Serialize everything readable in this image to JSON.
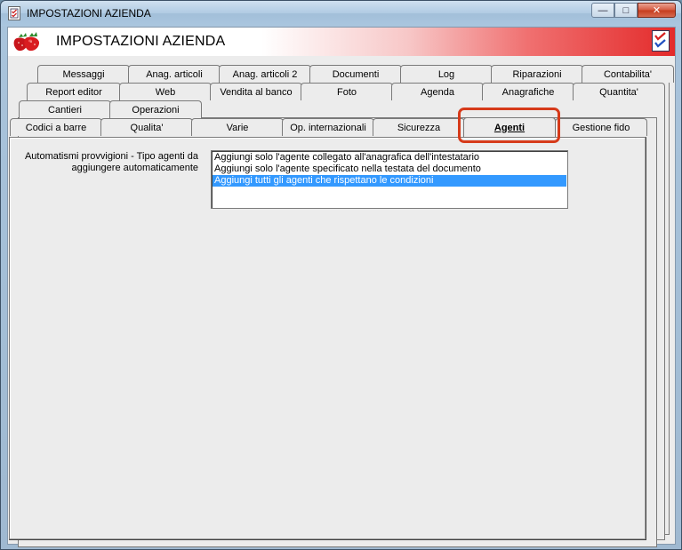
{
  "window": {
    "title": "IMPOSTAZIONI AZIENDA",
    "buttons": {
      "minimize": "—",
      "maximize": "□",
      "close": "✕"
    }
  },
  "header": {
    "title": "IMPOSTAZIONI AZIENDA",
    "logo_icon": "strawberry-icon",
    "right_icon": "checklist-icon"
  },
  "tabs": {
    "row1": [
      "Messaggi",
      "Anag. articoli",
      "Anag. articoli 2",
      "Documenti",
      "Log",
      "Riparazioni",
      "Contabilita'"
    ],
    "row2": [
      "Report editor",
      "Web",
      "Vendita al banco",
      "Foto",
      "Agenda",
      "Anagrafiche",
      "Quantita'"
    ],
    "row3": [
      "Cantieri",
      "Operazioni"
    ],
    "row4": [
      "Codici a barre",
      "Qualita'",
      "Varie",
      "Op. internazionali",
      "Sicurezza",
      "Agenti",
      "Gestione fido"
    ],
    "active": "Agenti"
  },
  "panel": {
    "field_label_line1": "Automatismi provvigioni - Tipo agenti da",
    "field_label_line2": "aggiungere automaticamente",
    "options": [
      "Aggiungi solo l'agente collegato all'anagrafica dell'intestatario",
      "Aggiungi solo l'agente specificato nella testata del documento",
      "Aggiungi tutti gli agenti che rispettano le condizioni"
    ],
    "selected_option": "Aggiungi tutti gli agenti che rispettano le condizioni"
  },
  "colors": {
    "selection": "#3399ff",
    "highlight_ring": "#d63a1a",
    "header_gradient_end": "#e32a2a"
  }
}
